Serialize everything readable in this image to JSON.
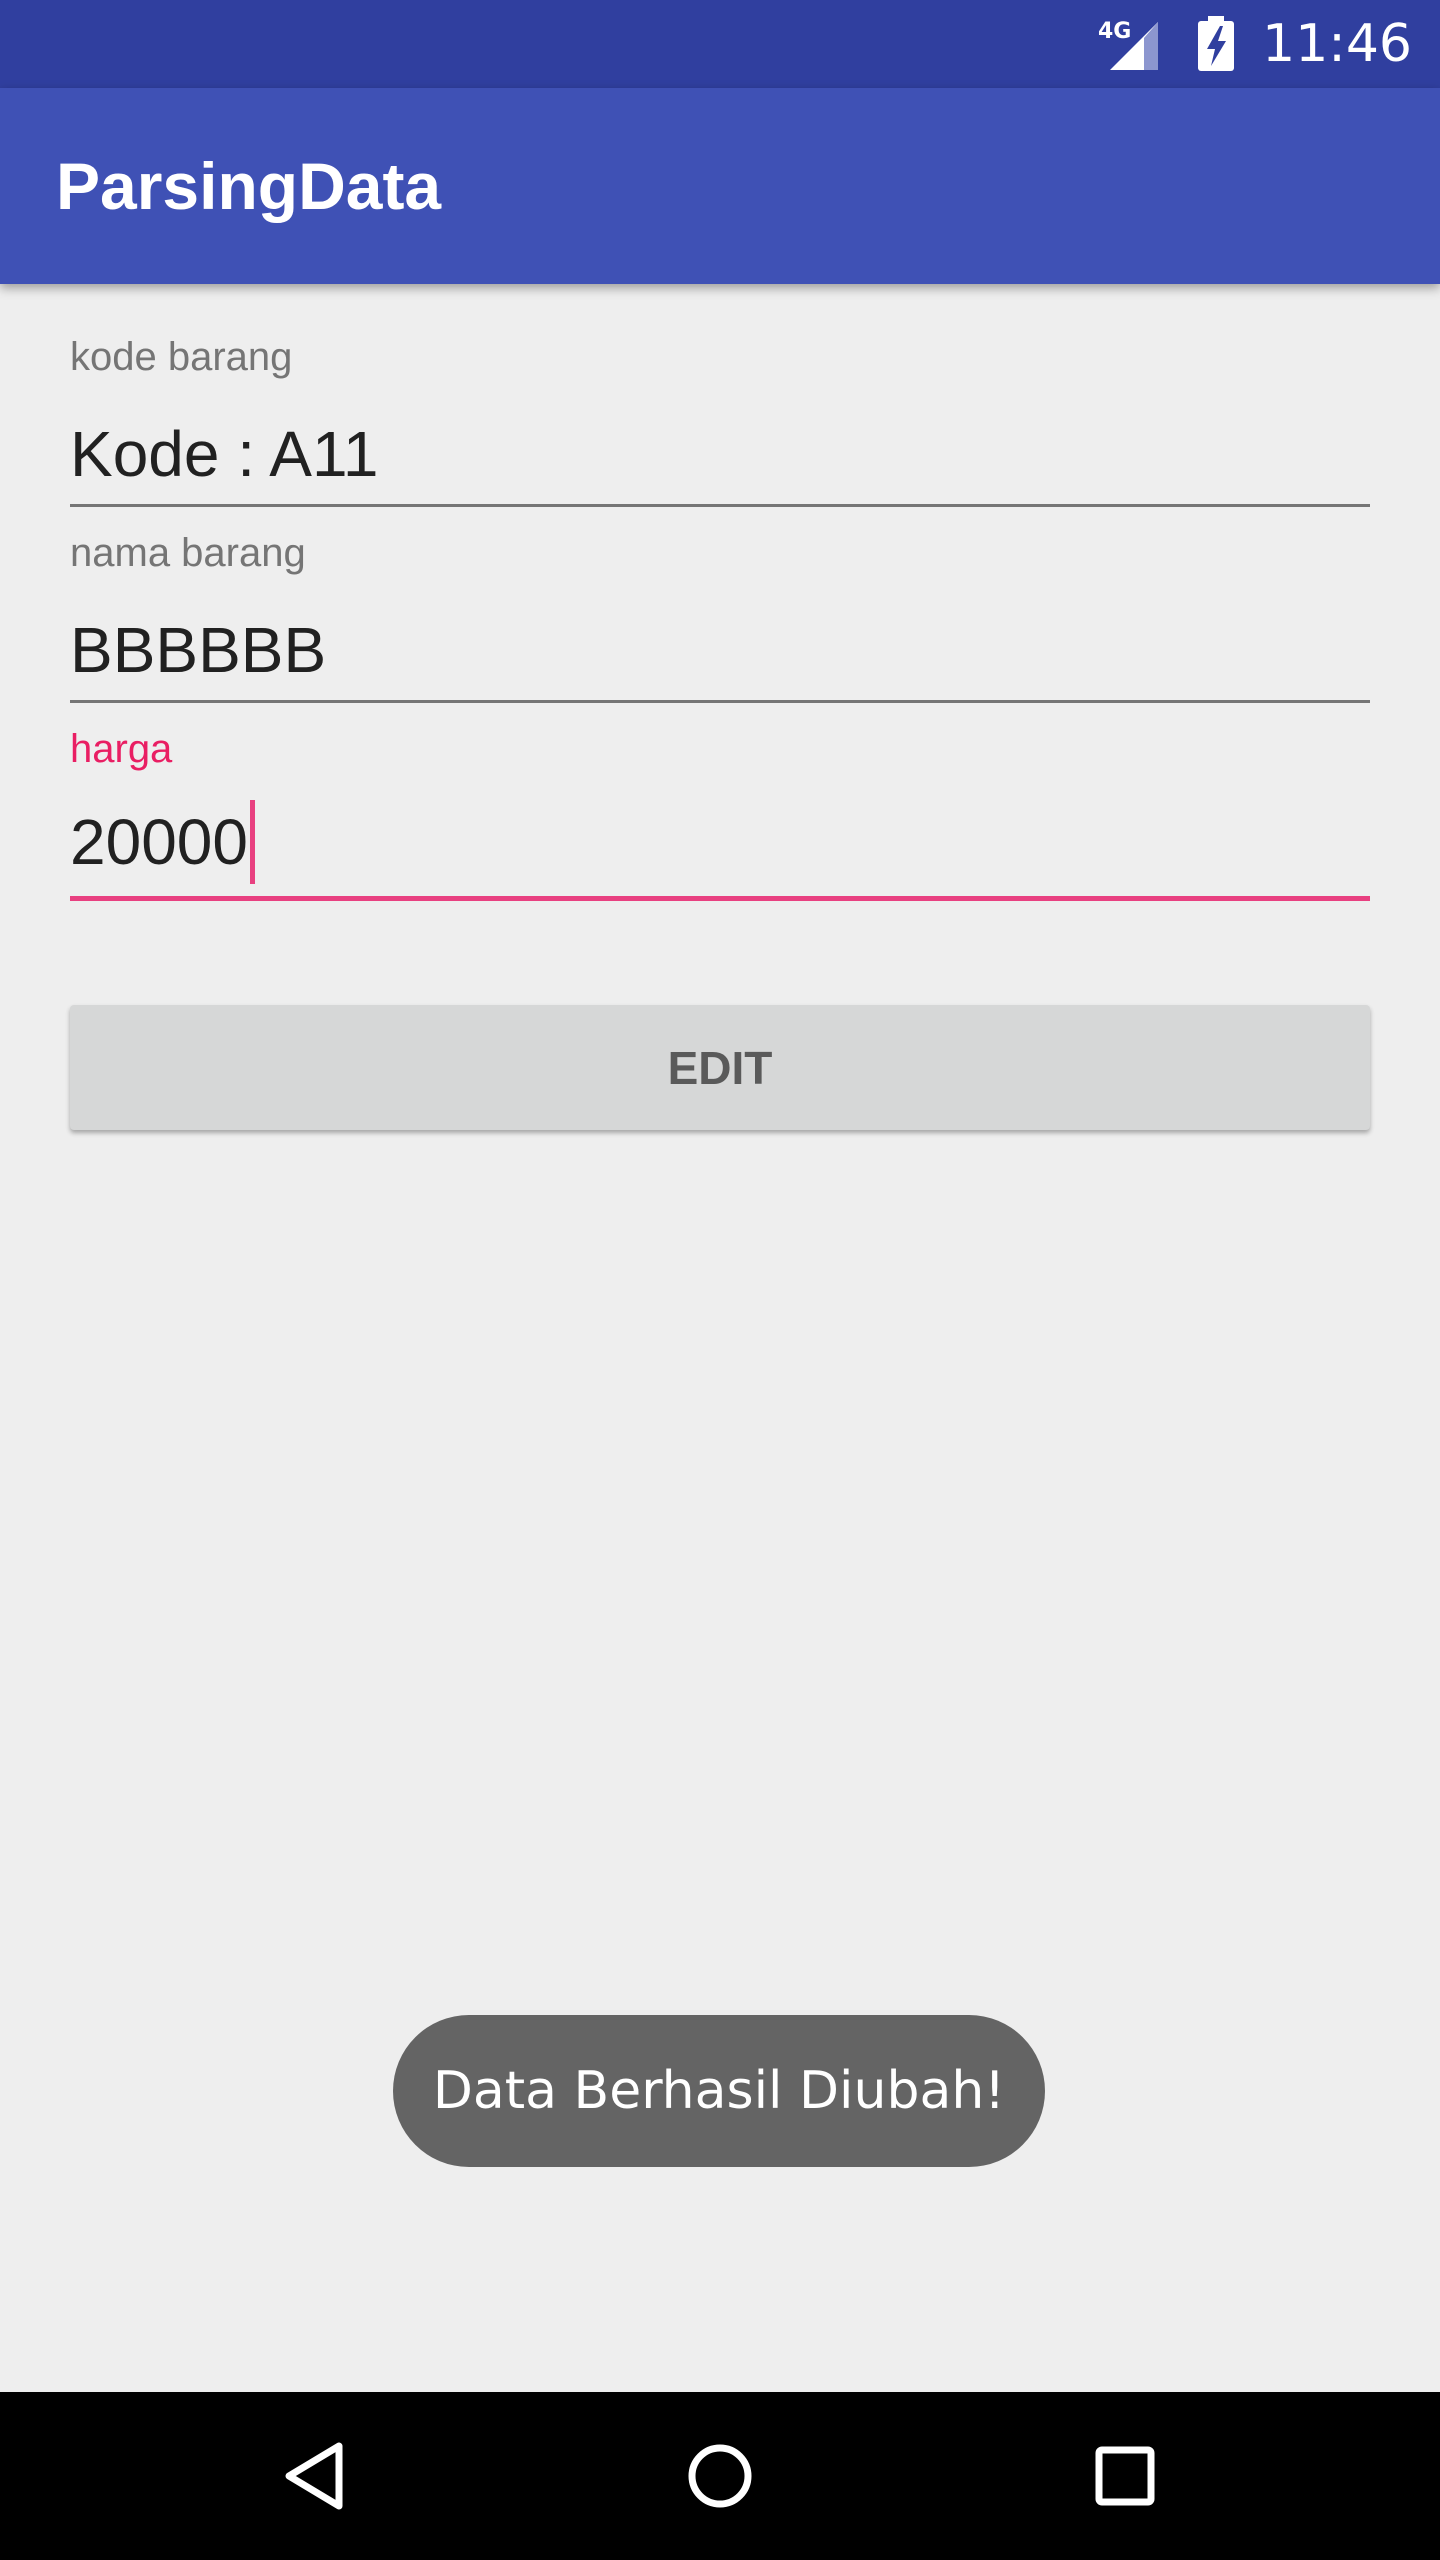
{
  "status_bar": {
    "network": "4G",
    "time": "11:46",
    "icons": [
      "signal-icon",
      "battery-charging-icon"
    ]
  },
  "app_bar": {
    "title": "ParsingData"
  },
  "form": {
    "kode": {
      "label": "kode barang",
      "value": "Kode : A11"
    },
    "nama": {
      "label": "nama barang",
      "value": "BBBBBB"
    },
    "harga": {
      "label": "harga",
      "value": "20000"
    }
  },
  "edit_button": {
    "label": "EDIT"
  },
  "toast": {
    "message": "Data Berhasil Diubah!"
  },
  "nav_bar": {
    "icons": [
      "back-icon",
      "home-icon",
      "recents-icon"
    ]
  },
  "colors": {
    "status_bar": "#303f9f",
    "app_bar": "#3f51b5",
    "accent": "#e91e63",
    "background": "#eeeeee",
    "toast": "#646464"
  }
}
